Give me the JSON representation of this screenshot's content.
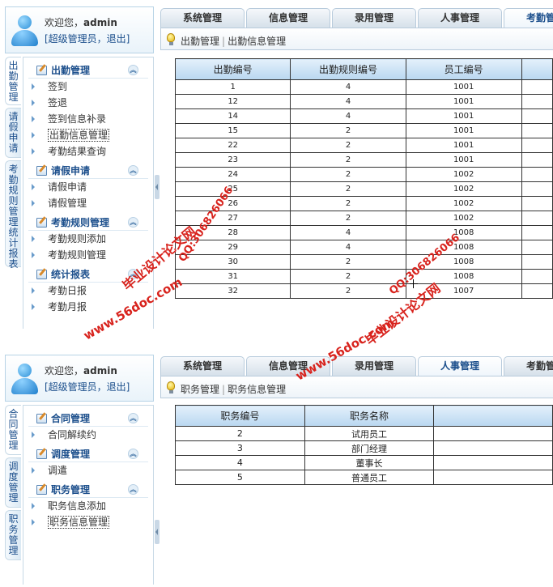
{
  "top": {
    "welcome_prefix": "欢迎您，",
    "username": "admin",
    "role_links": "[超级管理员，退出]",
    "side_tabs": [
      "出勤管理",
      "请假申请",
      "考勤规则管理统计报表"
    ],
    "menu": [
      {
        "title": "出勤管理",
        "items": [
          "签到",
          "签退",
          "签到信息补录",
          "出勤信息管理",
          "考勤结果查询"
        ]
      },
      {
        "title": "请假申请",
        "items": [
          "请假申请",
          "请假管理"
        ]
      },
      {
        "title": "考勤规则管理",
        "items": [
          "考勤规则添加",
          "考勤规则管理"
        ]
      },
      {
        "title": "统计报表",
        "items": [
          "考勤日报",
          "考勤月报"
        ]
      }
    ],
    "top_tabs": [
      "系统管理",
      "信息管理",
      "录用管理",
      "人事管理",
      "考勤管理"
    ],
    "breadcrumb": [
      "出勤管理",
      "出勤信息管理"
    ],
    "table": {
      "headers": [
        "出勤编号",
        "出勤规则编号",
        "员工编号",
        ""
      ],
      "rows": [
        [
          "1",
          "4",
          "1001"
        ],
        [
          "12",
          "4",
          "1001"
        ],
        [
          "14",
          "4",
          "1001"
        ],
        [
          "15",
          "2",
          "1001"
        ],
        [
          "22",
          "2",
          "1001"
        ],
        [
          "23",
          "2",
          "1001"
        ],
        [
          "24",
          "2",
          "1002"
        ],
        [
          "25",
          "2",
          "1002"
        ],
        [
          "26",
          "2",
          "1002"
        ],
        [
          "27",
          "2",
          "1002"
        ],
        [
          "28",
          "4",
          "1008"
        ],
        [
          "29",
          "4",
          "1008"
        ],
        [
          "30",
          "2",
          "1008"
        ],
        [
          "31",
          "2",
          "1008"
        ],
        [
          "32",
          "2",
          "1007"
        ]
      ]
    }
  },
  "bottom": {
    "welcome_prefix": "欢迎您，",
    "username": "admin",
    "role_links": "[超级管理员，退出]",
    "side_tabs": [
      "合同管理",
      "调度管理",
      "职务管理"
    ],
    "menu": [
      {
        "title": "合同管理",
        "items": [
          "合同解续约"
        ]
      },
      {
        "title": "调度管理",
        "items": [
          "调遣"
        ]
      },
      {
        "title": "职务管理",
        "items": [
          "职务信息添加",
          "职务信息管理"
        ]
      }
    ],
    "top_tabs": [
      "系统管理",
      "信息管理",
      "录用管理",
      "人事管理",
      "考勤管理"
    ],
    "breadcrumb": [
      "职务管理",
      "职务信息管理"
    ],
    "table": {
      "headers": [
        "职务编号",
        "职务名称",
        ""
      ],
      "rows": [
        [
          "2",
          "试用员工"
        ],
        [
          "3",
          "部门经理"
        ],
        [
          "4",
          "董事长"
        ],
        [
          "5",
          "普通员工"
        ]
      ]
    }
  },
  "watermarks": [
    "www.56doc.com",
    "毕业设计论文网",
    "QQ:306826066"
  ]
}
